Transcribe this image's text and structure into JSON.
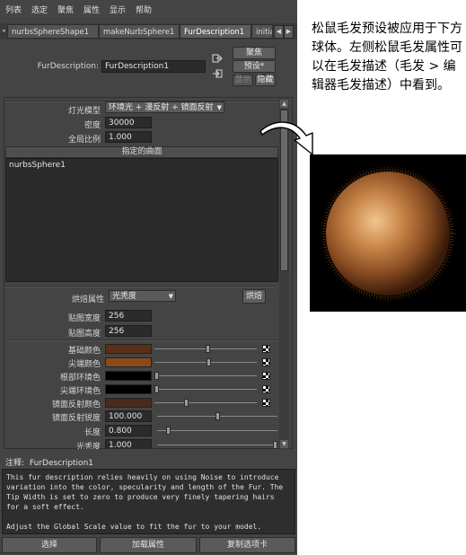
{
  "menubar": [
    "列表",
    "选定",
    "聚焦",
    "属性",
    "显示",
    "帮助"
  ],
  "tabs": [
    {
      "label": "nurbsSphereShape1",
      "active": false
    },
    {
      "label": "makeNurbSphere1",
      "active": false
    },
    {
      "label": "FurDescription1",
      "active": true
    },
    {
      "label": "initia",
      "active": false
    }
  ],
  "header": {
    "node_label": "FurDescription:",
    "node_value": "FurDescription1",
    "focus_btn": "聚焦",
    "preset_btn": "预设*",
    "show_btn": "显示",
    "hide_btn": "隐藏"
  },
  "attrs": {
    "light_model_label": "灯光模型",
    "light_model_value": "环境光 + 漫反射 + 镜面反射",
    "density_label": "密度",
    "density_value": "30000",
    "global_scale_label": "全局比例",
    "global_scale_value": "1.000",
    "surfaces_title": "指定的曲面",
    "surfaces": [
      "nurbsSphere1"
    ],
    "bake_label": "烘焙属性",
    "bake_value": "光秃度",
    "bake_btn": "烘焙",
    "map_width_label": "贴图宽度",
    "map_width_value": "256",
    "map_height_label": "贴图高度",
    "map_height_value": "256"
  },
  "color_rows": [
    {
      "label": "基础颜色",
      "color": "#5a2f15",
      "slider": 0.52
    },
    {
      "label": "尖端颜色",
      "color": "#8b4a1c",
      "slider": 0.53
    },
    {
      "label": "根部环境色",
      "color": "#000000",
      "slider": 0.0
    },
    {
      "label": "尖端环境色",
      "color": "#000000",
      "slider": 0.0
    },
    {
      "label": "镜面反射颜色",
      "color": "#4a2a1c",
      "slider": 0.3
    }
  ],
  "numeric_rows": [
    {
      "label": "镜面反射锐度",
      "value": "100.000",
      "slider": 0.5
    },
    {
      "label": "长度",
      "value": "0.800",
      "slider": 0.08
    },
    {
      "label": "光秃度",
      "value": "1.000",
      "slider": 1.0
    }
  ],
  "notes": {
    "label": "注释:",
    "title": "FurDescription1",
    "text": "This fur description relies heavily on using Noise to introduce variation into the color, specularity and length of the Fur. The Tip Width is set to zero to produce very finely tapering hairs for a soft effect.\n\nAdjust the Global Scale value to fit the fur to your model."
  },
  "bottom_buttons": [
    "选择",
    "加载属性",
    "复制选项卡"
  ],
  "caption": "松鼠毛发预设被应用于下方球体。左侧松鼠毛发属性可以在毛发描述（毛发 > 编辑器毛发描述）中看到。"
}
